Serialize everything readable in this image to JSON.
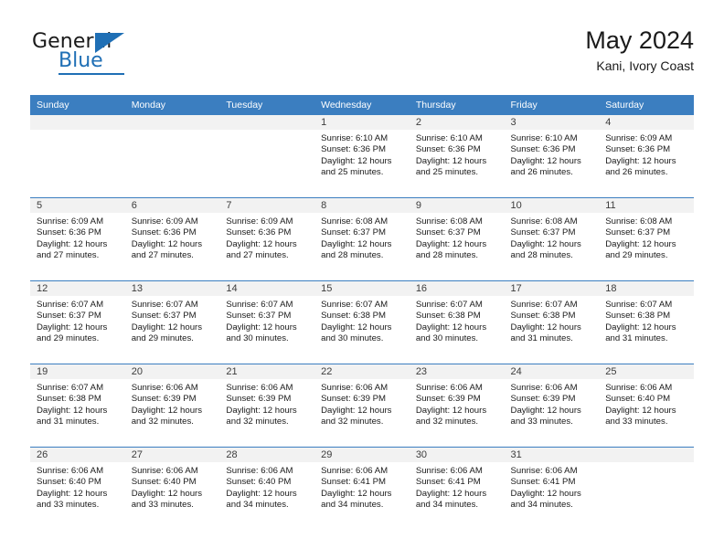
{
  "brand": {
    "name_top": "General",
    "name_bottom": "Blue"
  },
  "header": {
    "title": "May 2024",
    "subtitle": "Kani, Ivory Coast"
  },
  "weekday_headers": [
    "Sunday",
    "Monday",
    "Tuesday",
    "Wednesday",
    "Thursday",
    "Friday",
    "Saturday"
  ],
  "colors": {
    "header_blue": "#3b7ec0",
    "brand_blue": "#1f6fb5",
    "daynum_band": "#f2f2f2"
  },
  "weeks": [
    [
      {
        "day": "",
        "sunrise": "",
        "sunset": "",
        "daylight_line1": "",
        "daylight_line2": ""
      },
      {
        "day": "",
        "sunrise": "",
        "sunset": "",
        "daylight_line1": "",
        "daylight_line2": ""
      },
      {
        "day": "",
        "sunrise": "",
        "sunset": "",
        "daylight_line1": "",
        "daylight_line2": ""
      },
      {
        "day": "1",
        "sunrise": "Sunrise: 6:10 AM",
        "sunset": "Sunset: 6:36 PM",
        "daylight_line1": "Daylight: 12 hours",
        "daylight_line2": "and 25 minutes."
      },
      {
        "day": "2",
        "sunrise": "Sunrise: 6:10 AM",
        "sunset": "Sunset: 6:36 PM",
        "daylight_line1": "Daylight: 12 hours",
        "daylight_line2": "and 25 minutes."
      },
      {
        "day": "3",
        "sunrise": "Sunrise: 6:10 AM",
        "sunset": "Sunset: 6:36 PM",
        "daylight_line1": "Daylight: 12 hours",
        "daylight_line2": "and 26 minutes."
      },
      {
        "day": "4",
        "sunrise": "Sunrise: 6:09 AM",
        "sunset": "Sunset: 6:36 PM",
        "daylight_line1": "Daylight: 12 hours",
        "daylight_line2": "and 26 minutes."
      }
    ],
    [
      {
        "day": "5",
        "sunrise": "Sunrise: 6:09 AM",
        "sunset": "Sunset: 6:36 PM",
        "daylight_line1": "Daylight: 12 hours",
        "daylight_line2": "and 27 minutes."
      },
      {
        "day": "6",
        "sunrise": "Sunrise: 6:09 AM",
        "sunset": "Sunset: 6:36 PM",
        "daylight_line1": "Daylight: 12 hours",
        "daylight_line2": "and 27 minutes."
      },
      {
        "day": "7",
        "sunrise": "Sunrise: 6:09 AM",
        "sunset": "Sunset: 6:36 PM",
        "daylight_line1": "Daylight: 12 hours",
        "daylight_line2": "and 27 minutes."
      },
      {
        "day": "8",
        "sunrise": "Sunrise: 6:08 AM",
        "sunset": "Sunset: 6:37 PM",
        "daylight_line1": "Daylight: 12 hours",
        "daylight_line2": "and 28 minutes."
      },
      {
        "day": "9",
        "sunrise": "Sunrise: 6:08 AM",
        "sunset": "Sunset: 6:37 PM",
        "daylight_line1": "Daylight: 12 hours",
        "daylight_line2": "and 28 minutes."
      },
      {
        "day": "10",
        "sunrise": "Sunrise: 6:08 AM",
        "sunset": "Sunset: 6:37 PM",
        "daylight_line1": "Daylight: 12 hours",
        "daylight_line2": "and 28 minutes."
      },
      {
        "day": "11",
        "sunrise": "Sunrise: 6:08 AM",
        "sunset": "Sunset: 6:37 PM",
        "daylight_line1": "Daylight: 12 hours",
        "daylight_line2": "and 29 minutes."
      }
    ],
    [
      {
        "day": "12",
        "sunrise": "Sunrise: 6:07 AM",
        "sunset": "Sunset: 6:37 PM",
        "daylight_line1": "Daylight: 12 hours",
        "daylight_line2": "and 29 minutes."
      },
      {
        "day": "13",
        "sunrise": "Sunrise: 6:07 AM",
        "sunset": "Sunset: 6:37 PM",
        "daylight_line1": "Daylight: 12 hours",
        "daylight_line2": "and 29 minutes."
      },
      {
        "day": "14",
        "sunrise": "Sunrise: 6:07 AM",
        "sunset": "Sunset: 6:37 PM",
        "daylight_line1": "Daylight: 12 hours",
        "daylight_line2": "and 30 minutes."
      },
      {
        "day": "15",
        "sunrise": "Sunrise: 6:07 AM",
        "sunset": "Sunset: 6:38 PM",
        "daylight_line1": "Daylight: 12 hours",
        "daylight_line2": "and 30 minutes."
      },
      {
        "day": "16",
        "sunrise": "Sunrise: 6:07 AM",
        "sunset": "Sunset: 6:38 PM",
        "daylight_line1": "Daylight: 12 hours",
        "daylight_line2": "and 30 minutes."
      },
      {
        "day": "17",
        "sunrise": "Sunrise: 6:07 AM",
        "sunset": "Sunset: 6:38 PM",
        "daylight_line1": "Daylight: 12 hours",
        "daylight_line2": "and 31 minutes."
      },
      {
        "day": "18",
        "sunrise": "Sunrise: 6:07 AM",
        "sunset": "Sunset: 6:38 PM",
        "daylight_line1": "Daylight: 12 hours",
        "daylight_line2": "and 31 minutes."
      }
    ],
    [
      {
        "day": "19",
        "sunrise": "Sunrise: 6:07 AM",
        "sunset": "Sunset: 6:38 PM",
        "daylight_line1": "Daylight: 12 hours",
        "daylight_line2": "and 31 minutes."
      },
      {
        "day": "20",
        "sunrise": "Sunrise: 6:06 AM",
        "sunset": "Sunset: 6:39 PM",
        "daylight_line1": "Daylight: 12 hours",
        "daylight_line2": "and 32 minutes."
      },
      {
        "day": "21",
        "sunrise": "Sunrise: 6:06 AM",
        "sunset": "Sunset: 6:39 PM",
        "daylight_line1": "Daylight: 12 hours",
        "daylight_line2": "and 32 minutes."
      },
      {
        "day": "22",
        "sunrise": "Sunrise: 6:06 AM",
        "sunset": "Sunset: 6:39 PM",
        "daylight_line1": "Daylight: 12 hours",
        "daylight_line2": "and 32 minutes."
      },
      {
        "day": "23",
        "sunrise": "Sunrise: 6:06 AM",
        "sunset": "Sunset: 6:39 PM",
        "daylight_line1": "Daylight: 12 hours",
        "daylight_line2": "and 32 minutes."
      },
      {
        "day": "24",
        "sunrise": "Sunrise: 6:06 AM",
        "sunset": "Sunset: 6:39 PM",
        "daylight_line1": "Daylight: 12 hours",
        "daylight_line2": "and 33 minutes."
      },
      {
        "day": "25",
        "sunrise": "Sunrise: 6:06 AM",
        "sunset": "Sunset: 6:40 PM",
        "daylight_line1": "Daylight: 12 hours",
        "daylight_line2": "and 33 minutes."
      }
    ],
    [
      {
        "day": "26",
        "sunrise": "Sunrise: 6:06 AM",
        "sunset": "Sunset: 6:40 PM",
        "daylight_line1": "Daylight: 12 hours",
        "daylight_line2": "and 33 minutes."
      },
      {
        "day": "27",
        "sunrise": "Sunrise: 6:06 AM",
        "sunset": "Sunset: 6:40 PM",
        "daylight_line1": "Daylight: 12 hours",
        "daylight_line2": "and 33 minutes."
      },
      {
        "day": "28",
        "sunrise": "Sunrise: 6:06 AM",
        "sunset": "Sunset: 6:40 PM",
        "daylight_line1": "Daylight: 12 hours",
        "daylight_line2": "and 34 minutes."
      },
      {
        "day": "29",
        "sunrise": "Sunrise: 6:06 AM",
        "sunset": "Sunset: 6:41 PM",
        "daylight_line1": "Daylight: 12 hours",
        "daylight_line2": "and 34 minutes."
      },
      {
        "day": "30",
        "sunrise": "Sunrise: 6:06 AM",
        "sunset": "Sunset: 6:41 PM",
        "daylight_line1": "Daylight: 12 hours",
        "daylight_line2": "and 34 minutes."
      },
      {
        "day": "31",
        "sunrise": "Sunrise: 6:06 AM",
        "sunset": "Sunset: 6:41 PM",
        "daylight_line1": "Daylight: 12 hours",
        "daylight_line2": "and 34 minutes."
      },
      {
        "day": "",
        "sunrise": "",
        "sunset": "",
        "daylight_line1": "",
        "daylight_line2": ""
      }
    ]
  ]
}
